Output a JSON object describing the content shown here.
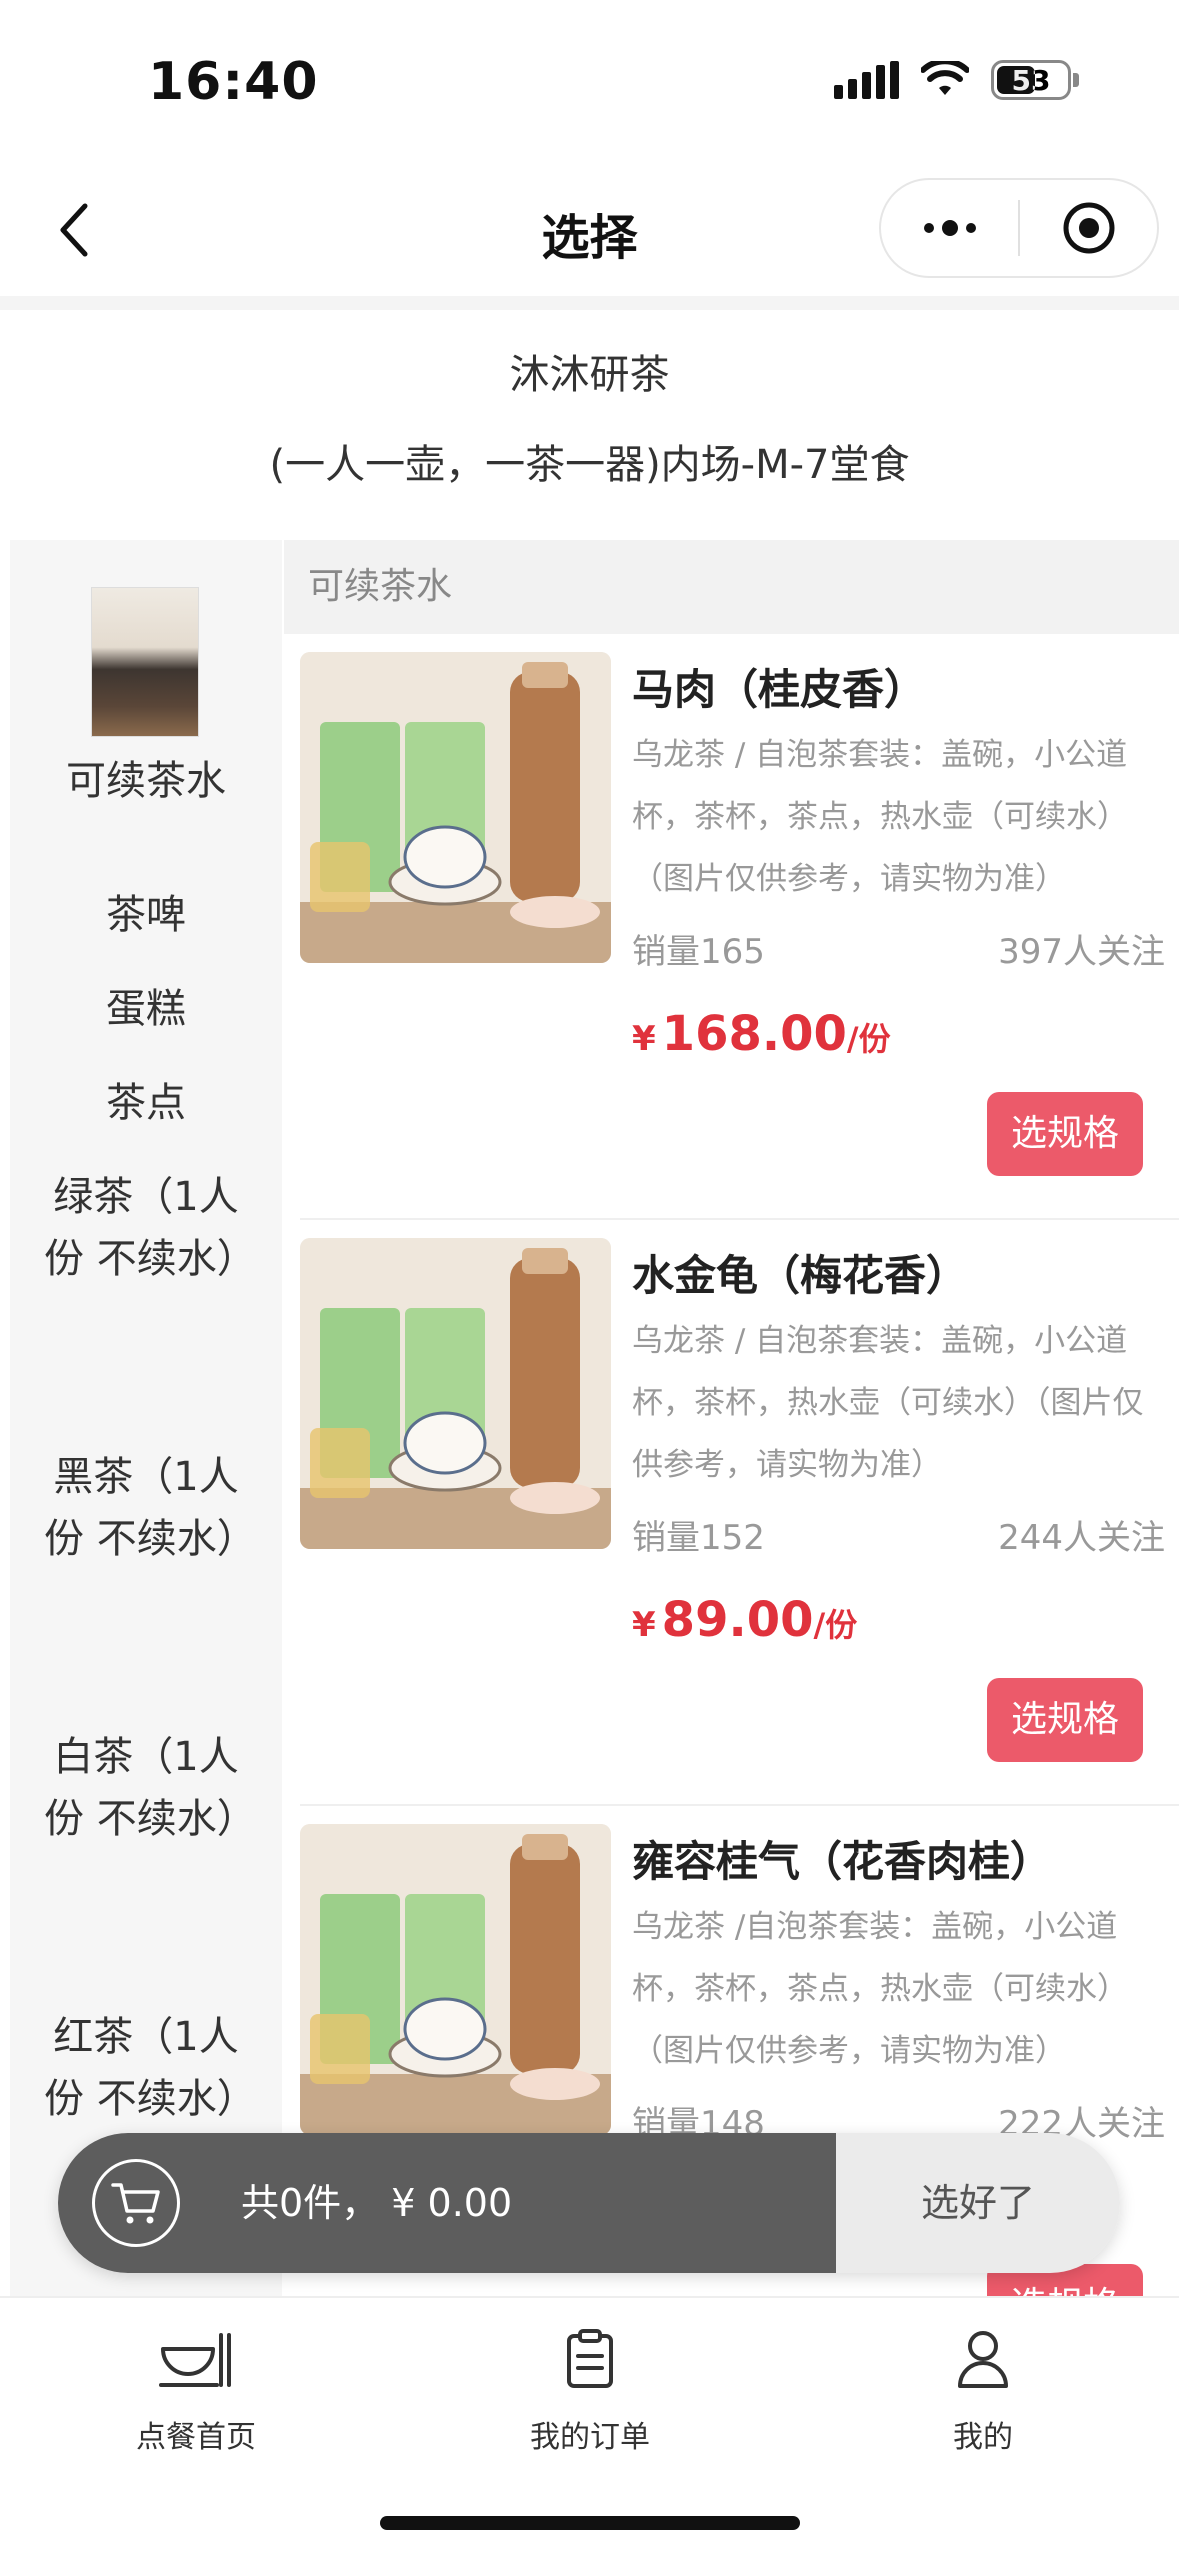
{
  "status_bar": {
    "time": "16:40",
    "battery": "53"
  },
  "nav": {
    "title": "选择"
  },
  "store": {
    "name": "沐沐研茶",
    "table": "(一人一壶，一茶一器)内场-M-7堂食"
  },
  "categories": [
    {
      "label": "可续茶水",
      "active": true
    },
    {
      "label": "茶啤"
    },
    {
      "label": "蛋糕"
    },
    {
      "label": "茶点"
    },
    {
      "label": "绿茶（1人份 不续水）"
    },
    {
      "label": "黑茶（1人份 不续水）"
    },
    {
      "label": "白茶（1人份 不续水）"
    },
    {
      "label": "红茶（1人份 不续水）"
    }
  ],
  "section": {
    "header": "可续茶水"
  },
  "products": [
    {
      "name": "马肉（桂皮香）",
      "desc": "乌龙茶 / 自泡茶套装：盖碗，小公道杯，茶杯，茶点，热水壶（可续水）（图片仅供参考，请实物为准）",
      "sales": "销量165",
      "follow": "397人关注",
      "price_symbol": "¥",
      "price": "168.00",
      "unit": "/份",
      "button": "选规格"
    },
    {
      "name": "水金龟（梅花香）",
      "desc": "乌龙茶 / 自泡茶套装：盖碗，小公道杯，茶杯，热水壶（可续水）（图片仅供参考，请实物为准）",
      "sales": "销量152",
      "follow": "244人关注",
      "price_symbol": "¥",
      "price": "89.00",
      "unit": "/份",
      "button": "选规格"
    },
    {
      "name": "雍容桂气（花香肉桂）",
      "desc": "乌龙茶 /自泡茶套装：盖碗，小公道杯，茶杯，茶点，热水壶（可续水）（图片仅供参考，请实物为准）",
      "sales": "销量148",
      "follow": "222人关注",
      "button": "选规格"
    }
  ],
  "cart": {
    "summary": "共0件，  ¥ 0.00",
    "confirm": "选好了"
  },
  "tabs": [
    {
      "label": "点餐首页",
      "icon": "bowl-icon"
    },
    {
      "label": "我的订单",
      "icon": "clipboard-icon"
    },
    {
      "label": "我的",
      "icon": "person-icon"
    }
  ],
  "colors": {
    "accent": "#e0323c",
    "button": "#ec5a6a",
    "cart_dark": "#5d5d5d"
  }
}
